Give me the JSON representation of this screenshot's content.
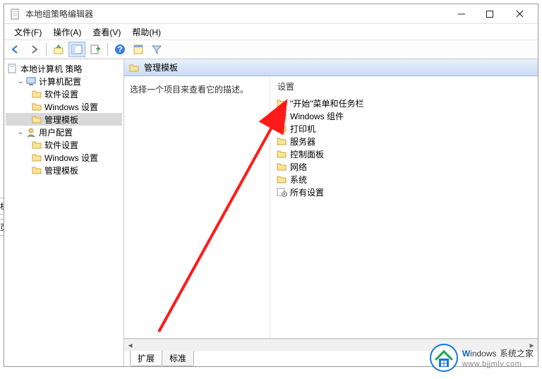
{
  "window": {
    "title": "本地组策略编辑器"
  },
  "menu": {
    "file": "文件(F)",
    "action": "操作(A)",
    "view": "查看(V)",
    "help": "帮助(H)"
  },
  "tree": {
    "root": "本地计算机 策略",
    "computer": "计算机配置",
    "c_software": "软件设置",
    "c_windows": "Windows 设置",
    "c_admin": "管理模板",
    "user": "用户配置",
    "u_software": "软件设置",
    "u_windows": "Windows 设置",
    "u_admin": "管理模板"
  },
  "breadcrumb": {
    "label": "管理模板"
  },
  "description": {
    "text": "选择一个项目来查看它的描述。"
  },
  "list": {
    "header": "设置",
    "items": [
      "\"开始\"菜单和任务栏",
      "Windows 组件",
      "打印机",
      "服务器",
      "控制面板",
      "网络",
      "系统",
      "所有设置"
    ]
  },
  "tabs": {
    "extended": "扩展",
    "standard": "标准"
  },
  "watermark": {
    "brand_prefix": "W",
    "brand_rest": "indows",
    "brand_suffix": "系统之家",
    "url": "www.bjjmlv.com"
  },
  "side": {
    "a": "机",
    "b": "页"
  }
}
